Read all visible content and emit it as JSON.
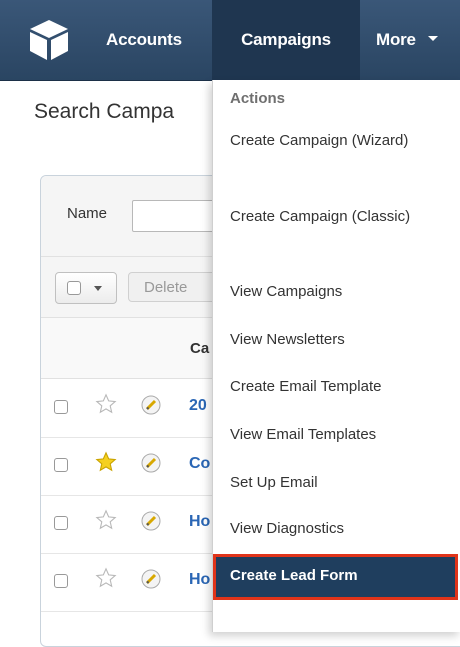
{
  "navbar": {
    "logo_icon": "sugar-cube-logo-icon",
    "items": [
      {
        "label": "Accounts"
      },
      {
        "label": "Campaigns"
      },
      {
        "label": "More"
      }
    ]
  },
  "page": {
    "title": "Search Campa",
    "search": {
      "name_label": "Name"
    },
    "actions": {
      "delete_label": "Delete"
    },
    "table": {
      "column_header": "Ca",
      "rows": [
        {
          "name": "20",
          "favorite": false
        },
        {
          "name": "Co",
          "favorite": true
        },
        {
          "name": "Ho",
          "favorite": false
        },
        {
          "name": "Ho",
          "favorite": false
        }
      ]
    }
  },
  "dropdown": {
    "header": "Actions",
    "items": [
      {
        "label": "Create Campaign (Wizard)"
      },
      {
        "label": "Create Campaign (Classic)"
      },
      {
        "label": "View Campaigns"
      },
      {
        "label": "View Newsletters"
      },
      {
        "label": "Create Email Template"
      },
      {
        "label": "View Email Templates"
      },
      {
        "label": "Set Up Email"
      },
      {
        "label": "View Diagnostics"
      },
      {
        "label": "Create Lead Form"
      }
    ],
    "highlight_color": "#e0341a",
    "active_bg": "#1f3e5e"
  },
  "colors": {
    "navbar": "#2f4b6b",
    "link": "#2a66b5",
    "star_favorite": "#f5d020"
  }
}
